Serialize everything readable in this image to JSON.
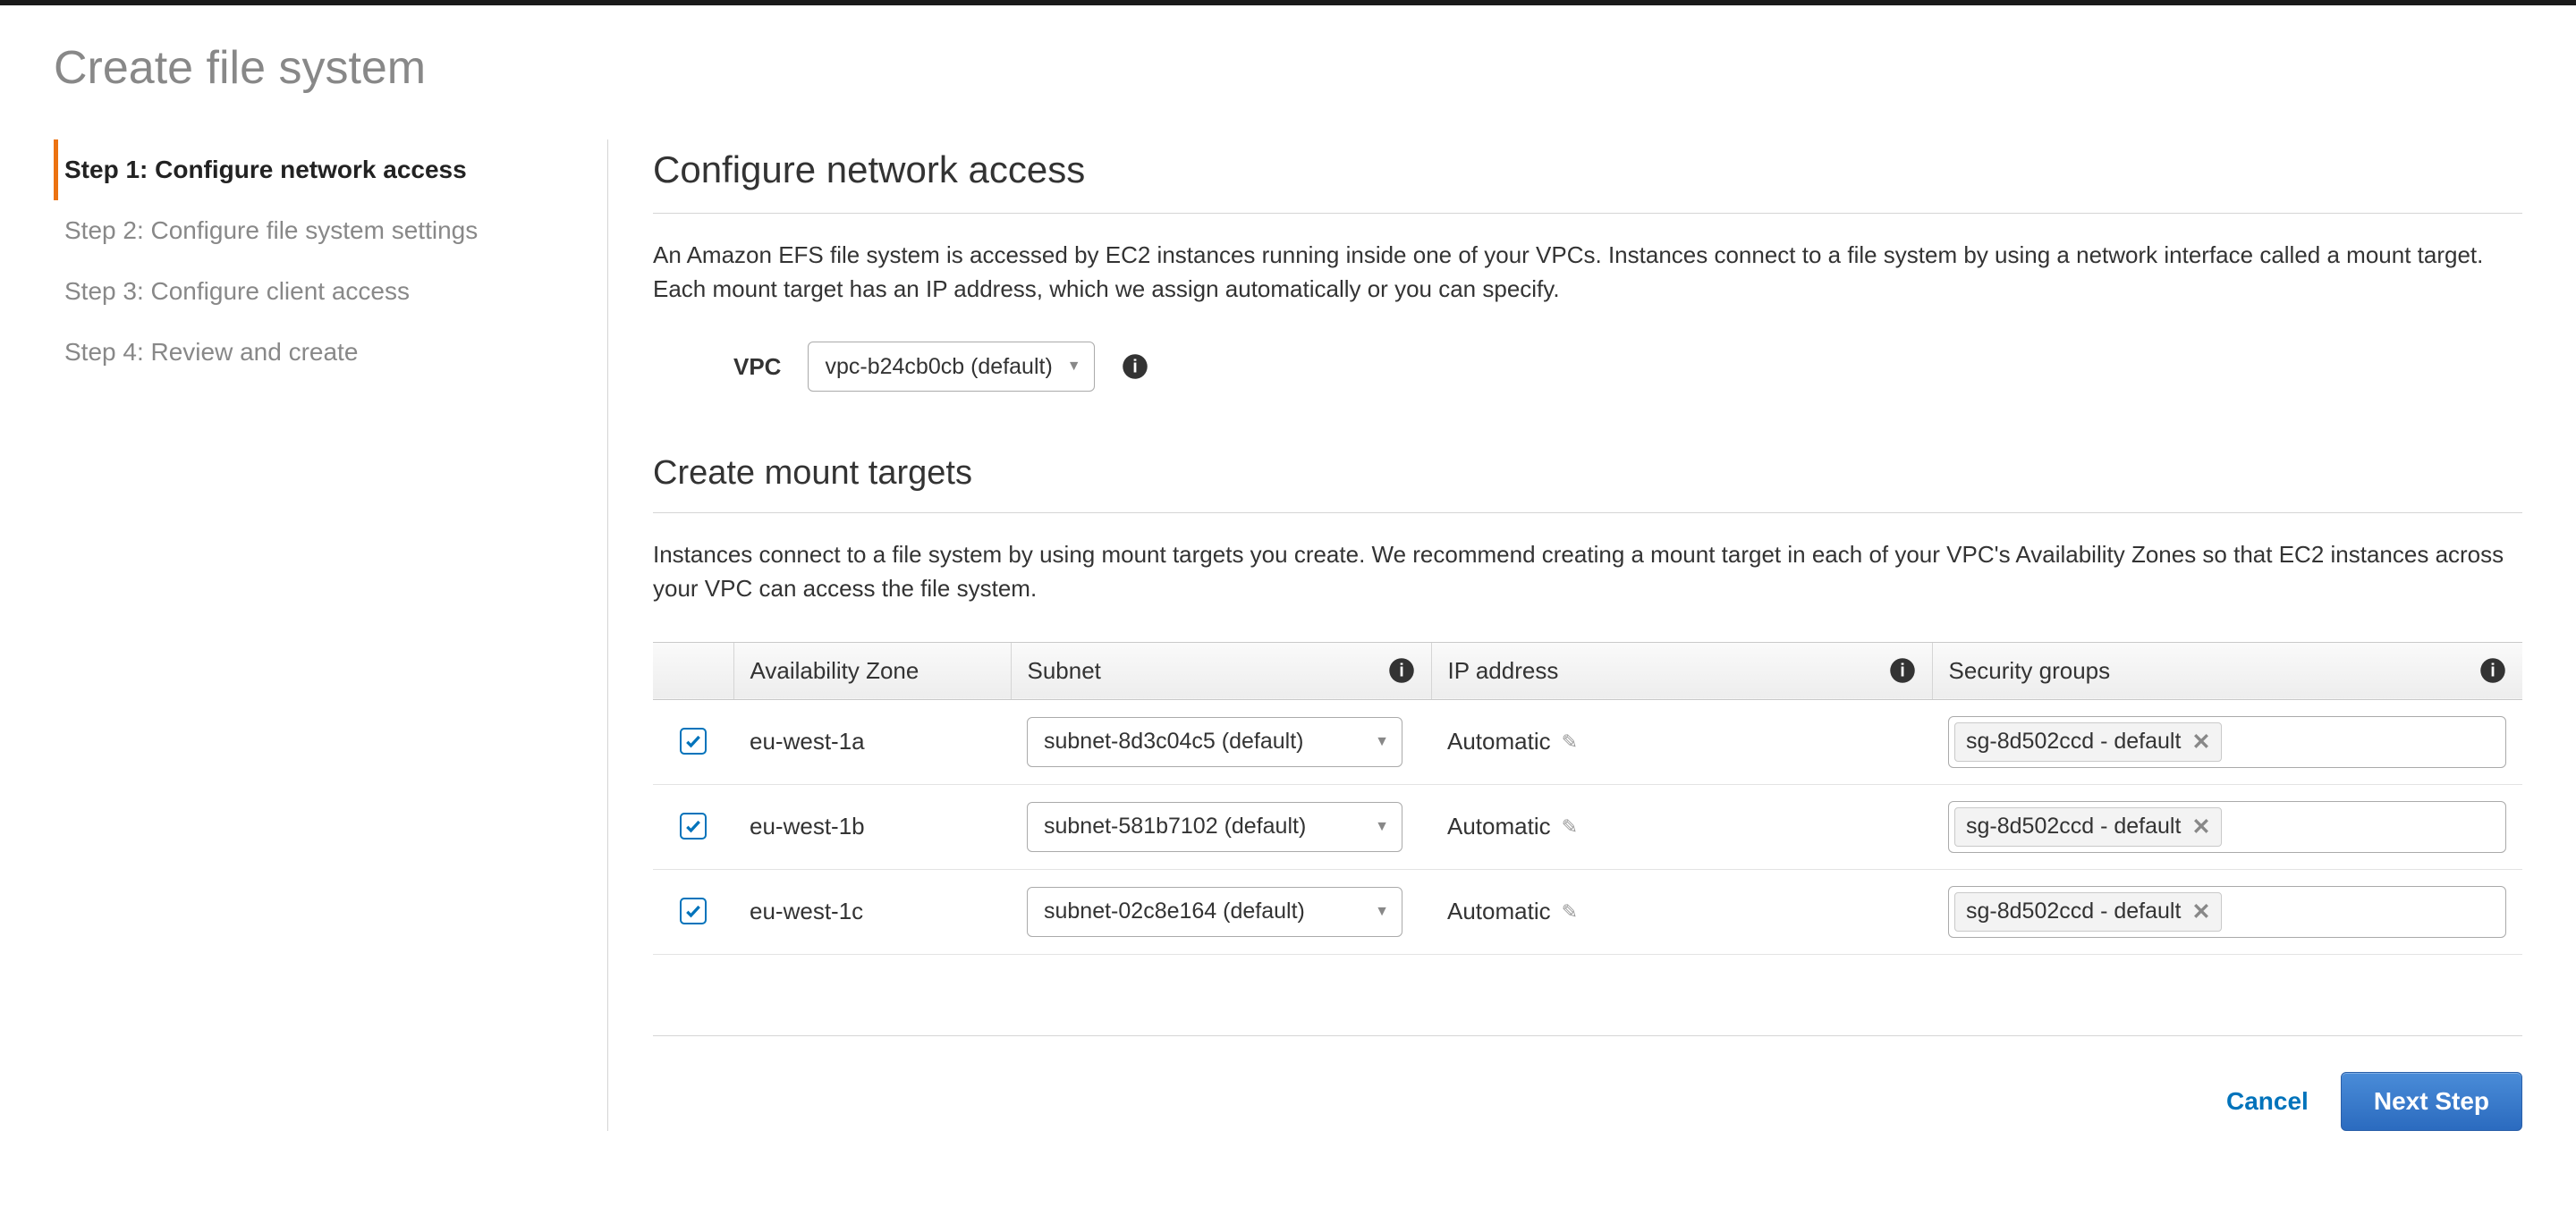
{
  "page_title": "Create file system",
  "sidebar": {
    "steps": [
      {
        "label": "Step 1: Configure network access",
        "active": true
      },
      {
        "label": "Step 2: Configure file system settings",
        "active": false
      },
      {
        "label": "Step 3: Configure client access",
        "active": false
      },
      {
        "label": "Step 4: Review and create",
        "active": false
      }
    ]
  },
  "main": {
    "configure_title": "Configure network access",
    "configure_desc": "An Amazon EFS file system is accessed by EC2 instances running inside one of your VPCs. Instances connect to a file system by using a network interface called a mount target. Each mount target has an IP address, which we assign automatically or you can specify.",
    "vpc_label": "VPC",
    "vpc_selected": "vpc-b24cb0cb (default)",
    "mount_targets_title": "Create mount targets",
    "mount_targets_desc": "Instances connect to a file system by using mount targets you create. We recommend creating a mount target in each of your VPC's Availability Zones so that EC2 instances across your VPC can access the file system.",
    "table": {
      "headers": {
        "az": "Availability Zone",
        "subnet": "Subnet",
        "ip": "IP address",
        "sg": "Security groups"
      },
      "rows": [
        {
          "checked": true,
          "az": "eu-west-1a",
          "subnet": "subnet-8d3c04c5 (default)",
          "ip": "Automatic",
          "sg": "sg-8d502ccd - default"
        },
        {
          "checked": true,
          "az": "eu-west-1b",
          "subnet": "subnet-581b7102 (default)",
          "ip": "Automatic",
          "sg": "sg-8d502ccd - default"
        },
        {
          "checked": true,
          "az": "eu-west-1c",
          "subnet": "subnet-02c8e164 (default)",
          "ip": "Automatic",
          "sg": "sg-8d502ccd - default"
        }
      ]
    }
  },
  "footer": {
    "cancel": "Cancel",
    "next": "Next Step"
  }
}
